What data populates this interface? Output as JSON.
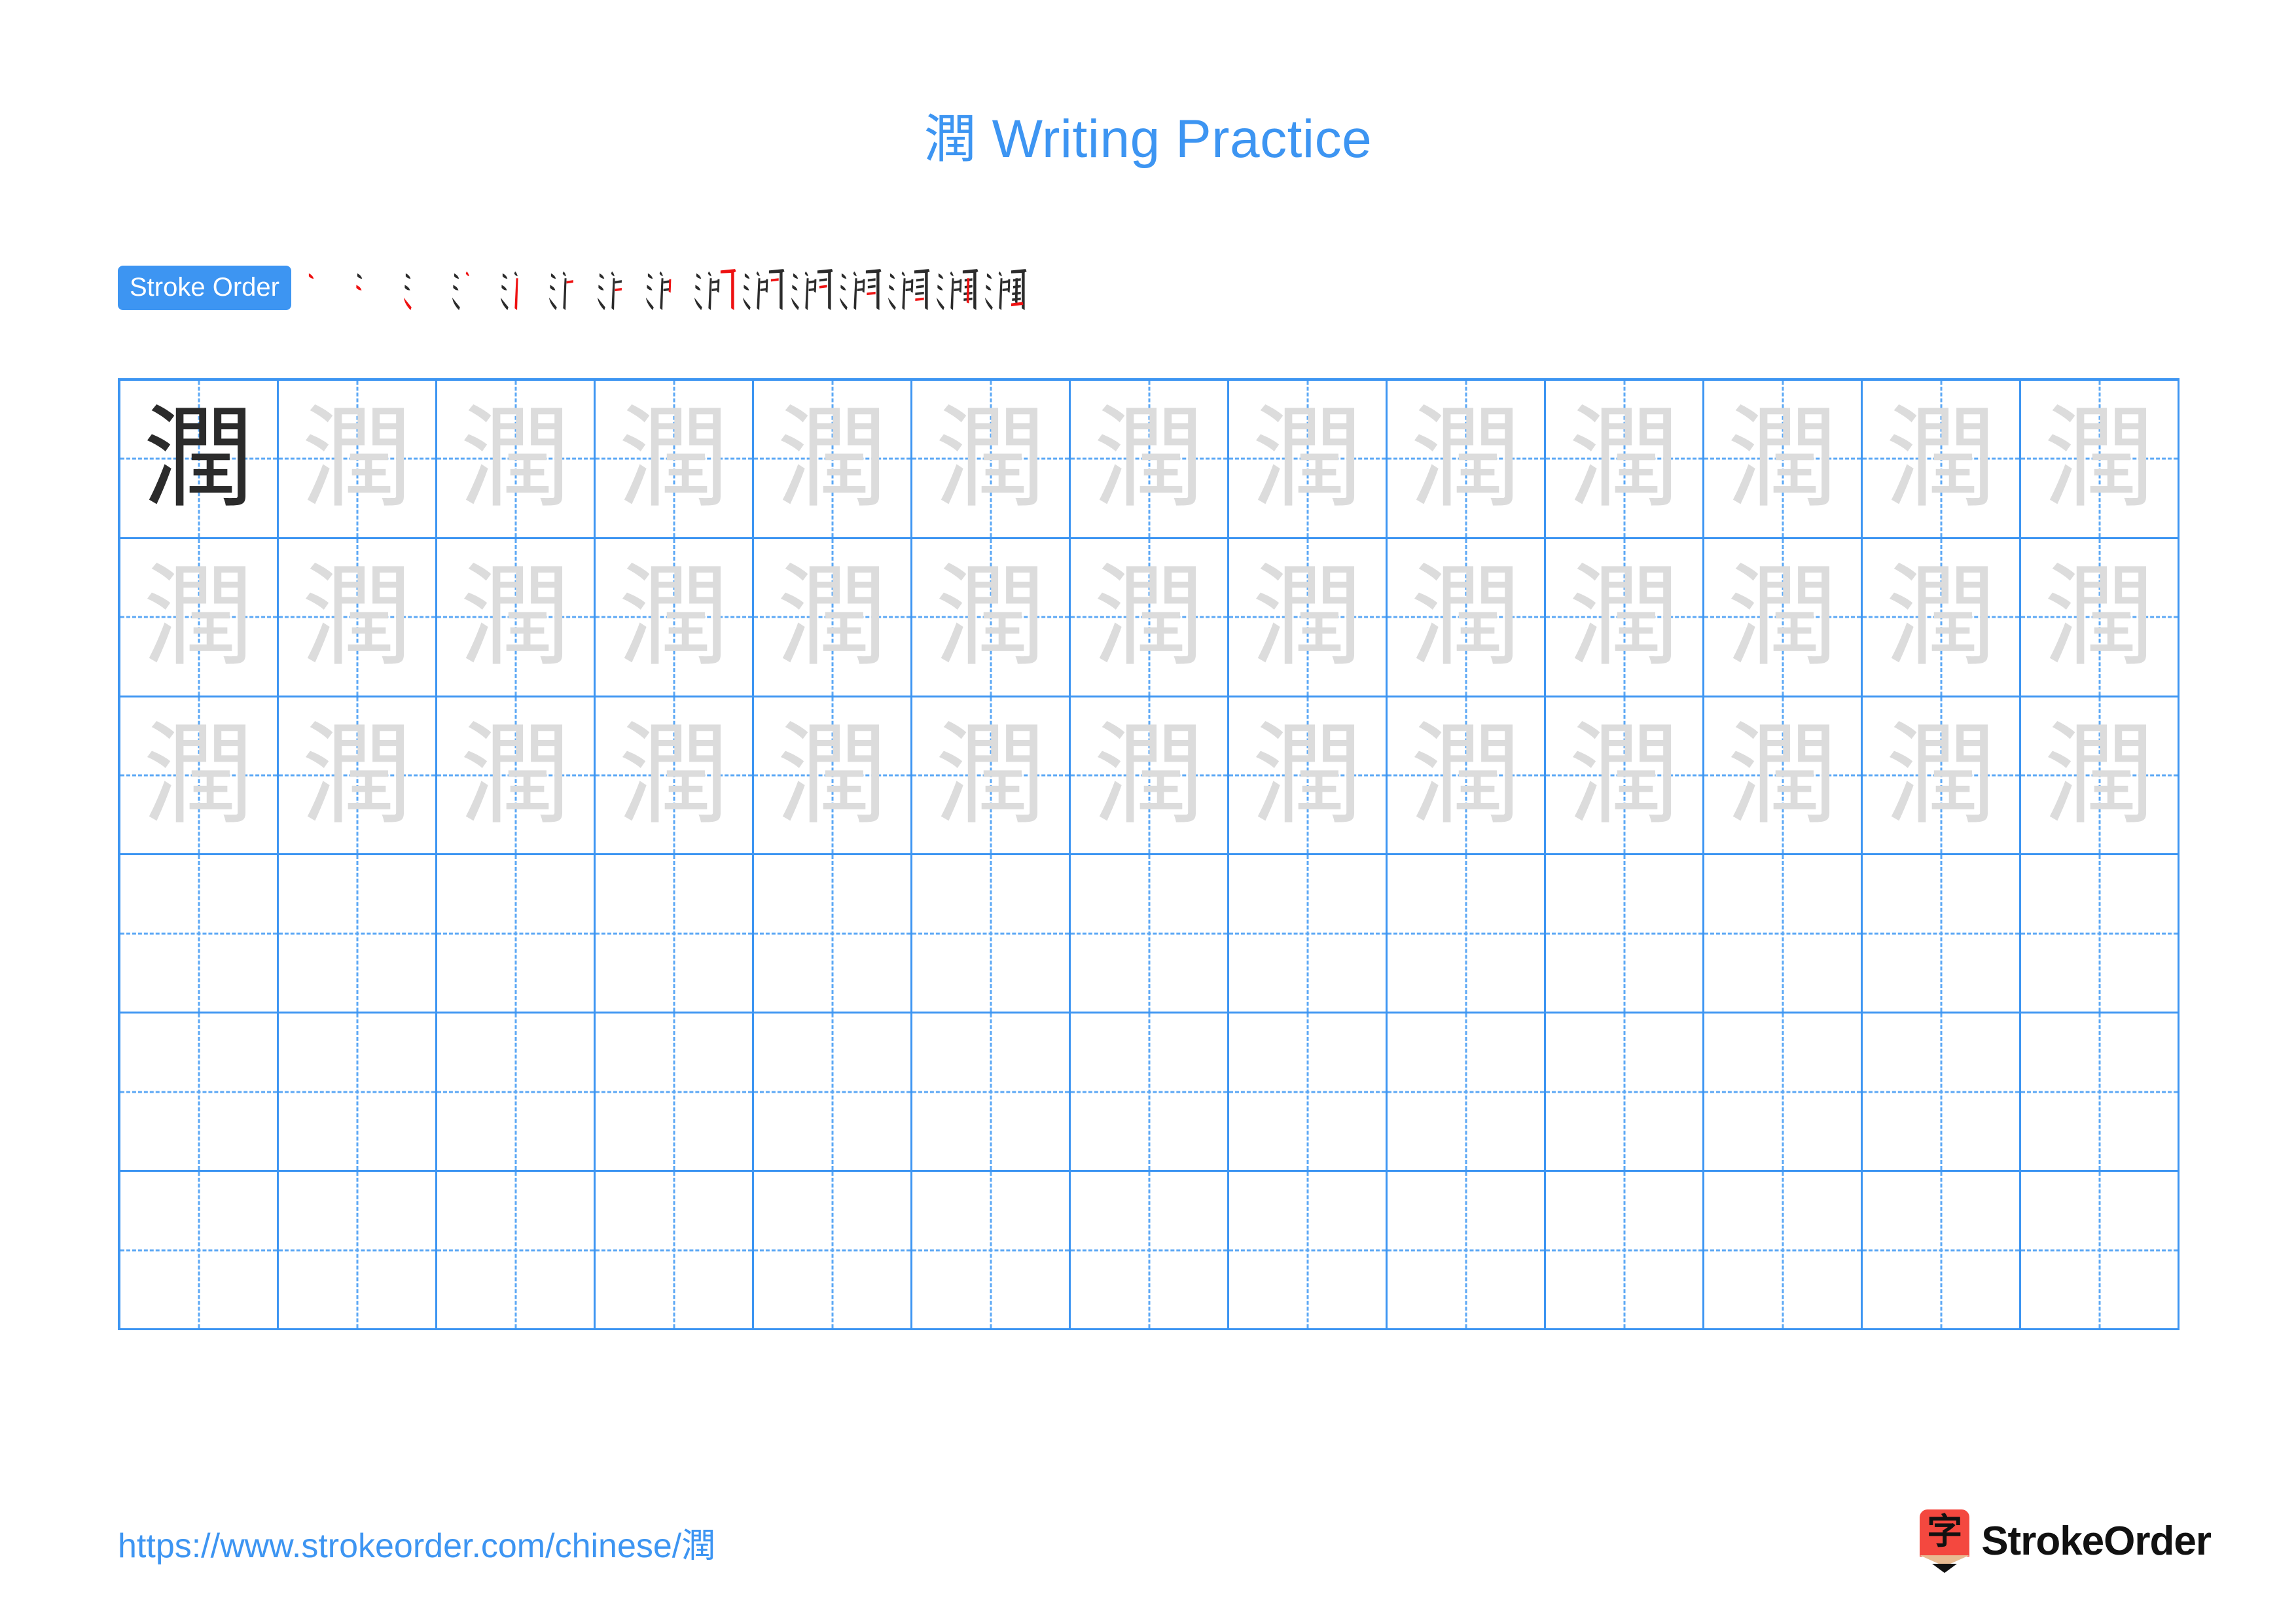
{
  "character": "潤",
  "title": {
    "hanzi": "潤",
    "text": " Writing Practice",
    "full": "潤 Writing Practice"
  },
  "colors": {
    "accent_blue": "#3d95f2",
    "guide_blue": "#5ca8f5",
    "stroke_dark": "#2b2b2b",
    "stroke_new_red": "#ee1111",
    "trace_gray": "#dcdcdc",
    "logo_red": "#f4483f",
    "logo_wood": "#e8bb92"
  },
  "stroke_order": {
    "label": "Stroke Order",
    "total_strokes": 15,
    "steps": [
      {
        "index": 1,
        "new_stroke": "dot",
        "glyph": "丶"
      },
      {
        "index": 2,
        "new_stroke": "dot",
        "glyph": "冫"
      },
      {
        "index": 3,
        "new_stroke": "rising-stroke",
        "glyph": "氵"
      },
      {
        "index": 4,
        "new_stroke": "vertical",
        "glyph": "汀-partial"
      },
      {
        "index": 5,
        "new_stroke": "horizontal-bend",
        "glyph": "沪-partial"
      },
      {
        "index": 6,
        "new_stroke": "short-horizontal",
        "glyph": "沪-partial"
      },
      {
        "index": 7,
        "new_stroke": "short-horizontal",
        "glyph": "沪-partial"
      },
      {
        "index": 8,
        "new_stroke": "vertical",
        "glyph": "沪-partial"
      },
      {
        "index": 9,
        "new_stroke": "vertical-hook",
        "glyph": "洐-partial"
      },
      {
        "index": 10,
        "new_stroke": "short-horizontal",
        "glyph": "閒-partial"
      },
      {
        "index": 11,
        "new_stroke": "short-horizontal",
        "glyph": "閒-partial"
      },
      {
        "index": 12,
        "new_stroke": "short-horizontal",
        "glyph": "潤-partial"
      },
      {
        "index": 13,
        "new_stroke": "short-horizontal",
        "glyph": "潤-partial"
      },
      {
        "index": 14,
        "new_stroke": "vertical",
        "glyph": "潤-partial"
      },
      {
        "index": 15,
        "new_stroke": "long-horizontal",
        "glyph": "潤"
      }
    ]
  },
  "grid": {
    "columns": 13,
    "rows": 6,
    "model_cell_index": 0,
    "trace_rows": 3,
    "blank_rows": 3,
    "cells": [
      [
        "潤",
        "潤",
        "潤",
        "潤",
        "潤",
        "潤",
        "潤",
        "潤",
        "潤",
        "潤",
        "潤",
        "潤",
        "潤"
      ],
      [
        "潤",
        "潤",
        "潤",
        "潤",
        "潤",
        "潤",
        "潤",
        "潤",
        "潤",
        "潤",
        "潤",
        "潤",
        "潤"
      ],
      [
        "潤",
        "潤",
        "潤",
        "潤",
        "潤",
        "潤",
        "潤",
        "潤",
        "潤",
        "潤",
        "潤",
        "潤",
        "潤"
      ],
      [
        "",
        "",
        "",
        "",
        "",
        "",
        "",
        "",
        "",
        "",
        "",
        "",
        ""
      ],
      [
        "",
        "",
        "",
        "",
        "",
        "",
        "",
        "",
        "",
        "",
        "",
        "",
        ""
      ],
      [
        "",
        "",
        "",
        "",
        "",
        "",
        "",
        "",
        "",
        "",
        "",
        "",
        ""
      ]
    ]
  },
  "footer": {
    "url_prefix": "https://www.strokeorder.com/chinese/",
    "url_hanzi": "潤",
    "url_full": "https://www.strokeorder.com/chinese/潤",
    "brand_name": "StrokeOrder",
    "brand_logo_glyph": "字"
  }
}
